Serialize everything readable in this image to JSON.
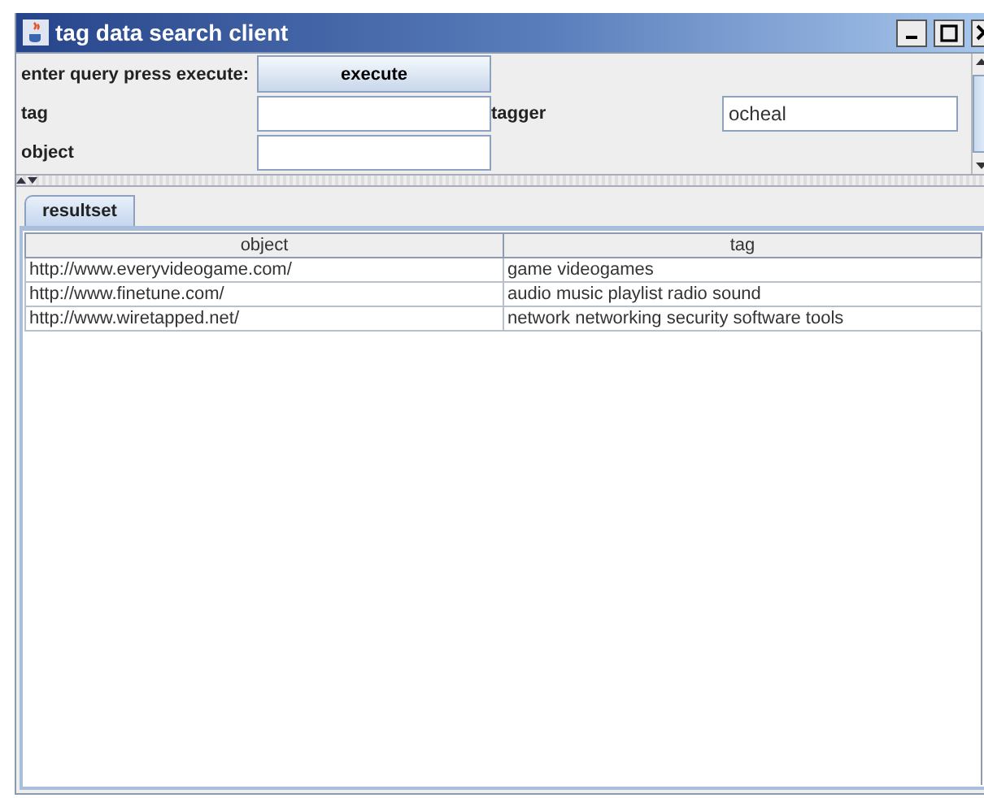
{
  "window": {
    "title": "tag data search client"
  },
  "form": {
    "prompt": "enter query press execute:",
    "execute_button": "execute",
    "fields": [
      {
        "label": "tag"
      },
      {
        "label": "tagger",
        "value": "ocheal"
      },
      {
        "label": "object"
      }
    ]
  },
  "tabs": [
    {
      "label": "resultset",
      "selected": true
    }
  ],
  "table": {
    "columns": [
      "object",
      "tag"
    ],
    "rows": [
      [
        "http://www.everyvideogame.com/",
        "game videogames"
      ],
      [
        "http://www.finetune.com/",
        "audio music playlist radio sound"
      ],
      [
        "http://www.wiretapped.net/",
        "network networking security software tools"
      ]
    ]
  }
}
